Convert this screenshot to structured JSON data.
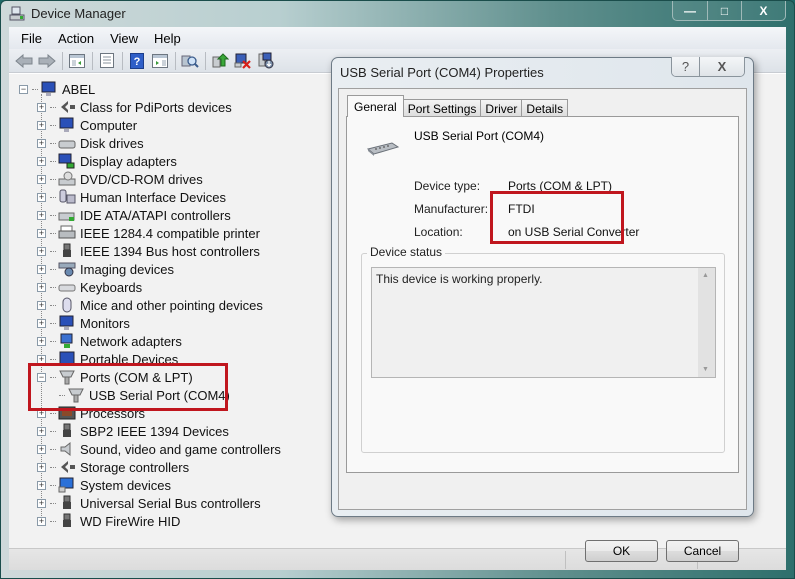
{
  "main_window": {
    "title": "Device Manager",
    "caption_buttons": {
      "minimize": "—",
      "maximize": "□",
      "close": "X"
    },
    "menu": [
      "File",
      "Action",
      "View",
      "Help"
    ],
    "toolbar": [
      {
        "icon": "back-arrow-icon"
      },
      {
        "icon": "forward-arrow-icon"
      },
      {
        "icon": "show-hide-console-tree-icon"
      },
      {
        "icon": "properties-icon"
      },
      {
        "icon": "help-icon"
      },
      {
        "icon": "show-hide-action-pane-icon"
      },
      {
        "icon": "scan-hardware-changes-icon"
      },
      {
        "icon": "update-driver-icon"
      },
      {
        "icon": "uninstall-icon"
      },
      {
        "icon": "disable-device-icon"
      }
    ]
  },
  "tree": {
    "root": "ABEL",
    "items": [
      {
        "label": "Class for PdiPorts devices",
        "icon": "class-icon",
        "expanded": false
      },
      {
        "label": "Computer",
        "icon": "computer-icon",
        "expanded": false
      },
      {
        "label": "Disk drives",
        "icon": "disk-drive-icon",
        "expanded": false
      },
      {
        "label": "Display adapters",
        "icon": "display-adapter-icon",
        "expanded": false
      },
      {
        "label": "DVD/CD-ROM drives",
        "icon": "dvd-drive-icon",
        "expanded": false
      },
      {
        "label": "Human Interface Devices",
        "icon": "hid-icon",
        "expanded": false
      },
      {
        "label": "IDE ATA/ATAPI controllers",
        "icon": "ide-controller-icon",
        "expanded": false
      },
      {
        "label": "IEEE 1284.4 compatible printer",
        "icon": "printer-icon",
        "expanded": false
      },
      {
        "label": "IEEE 1394 Bus host controllers",
        "icon": "firewire-icon",
        "expanded": false
      },
      {
        "label": "Imaging devices",
        "icon": "camera-icon",
        "expanded": false
      },
      {
        "label": "Keyboards",
        "icon": "keyboard-icon",
        "expanded": false
      },
      {
        "label": "Mice and other pointing devices",
        "icon": "mouse-icon",
        "expanded": false
      },
      {
        "label": "Monitors",
        "icon": "monitor-icon",
        "expanded": false
      },
      {
        "label": "Network adapters",
        "icon": "network-adapter-icon",
        "expanded": false
      },
      {
        "label": "Portable Devices",
        "icon": "portable-device-icon",
        "expanded": false
      },
      {
        "label": "Ports (COM & LPT)",
        "icon": "port-icon",
        "expanded": true,
        "children": [
          "USB Serial Port (COM4)"
        ]
      },
      {
        "label": "Processors",
        "icon": "processor-icon",
        "expanded": false
      },
      {
        "label": "SBP2 IEEE 1394 Devices",
        "icon": "firewire-icon",
        "expanded": false
      },
      {
        "label": "Sound, video and game controllers",
        "icon": "speaker-icon",
        "expanded": false
      },
      {
        "label": "Storage controllers",
        "icon": "storage-controller-icon",
        "expanded": false
      },
      {
        "label": "System devices",
        "icon": "system-device-icon",
        "expanded": false
      },
      {
        "label": "Universal Serial Bus controllers",
        "icon": "usb-icon",
        "expanded": false
      },
      {
        "label": "WD FireWire HID",
        "icon": "usb-icon",
        "expanded": false
      }
    ]
  },
  "dialog": {
    "title": "USB Serial Port (COM4) Properties",
    "help_label": "?",
    "close_label": "X",
    "tabs": [
      {
        "label": "General",
        "active": true
      },
      {
        "label": "Port Settings",
        "active": false
      },
      {
        "label": "Driver",
        "active": false
      },
      {
        "label": "Details",
        "active": false
      }
    ],
    "device_name": "USB Serial Port (COM4)",
    "properties": [
      {
        "label": "Device type:",
        "value": "Ports (COM & LPT)"
      },
      {
        "label": "Manufacturer:",
        "value": "FTDI"
      },
      {
        "label": "Location:",
        "value": "on USB Serial Converter"
      }
    ],
    "status_group_label": "Device status",
    "status_text": "This device is working properly.",
    "ok_label": "OK",
    "cancel_label": "Cancel"
  },
  "highlight_color": "#c0161e"
}
